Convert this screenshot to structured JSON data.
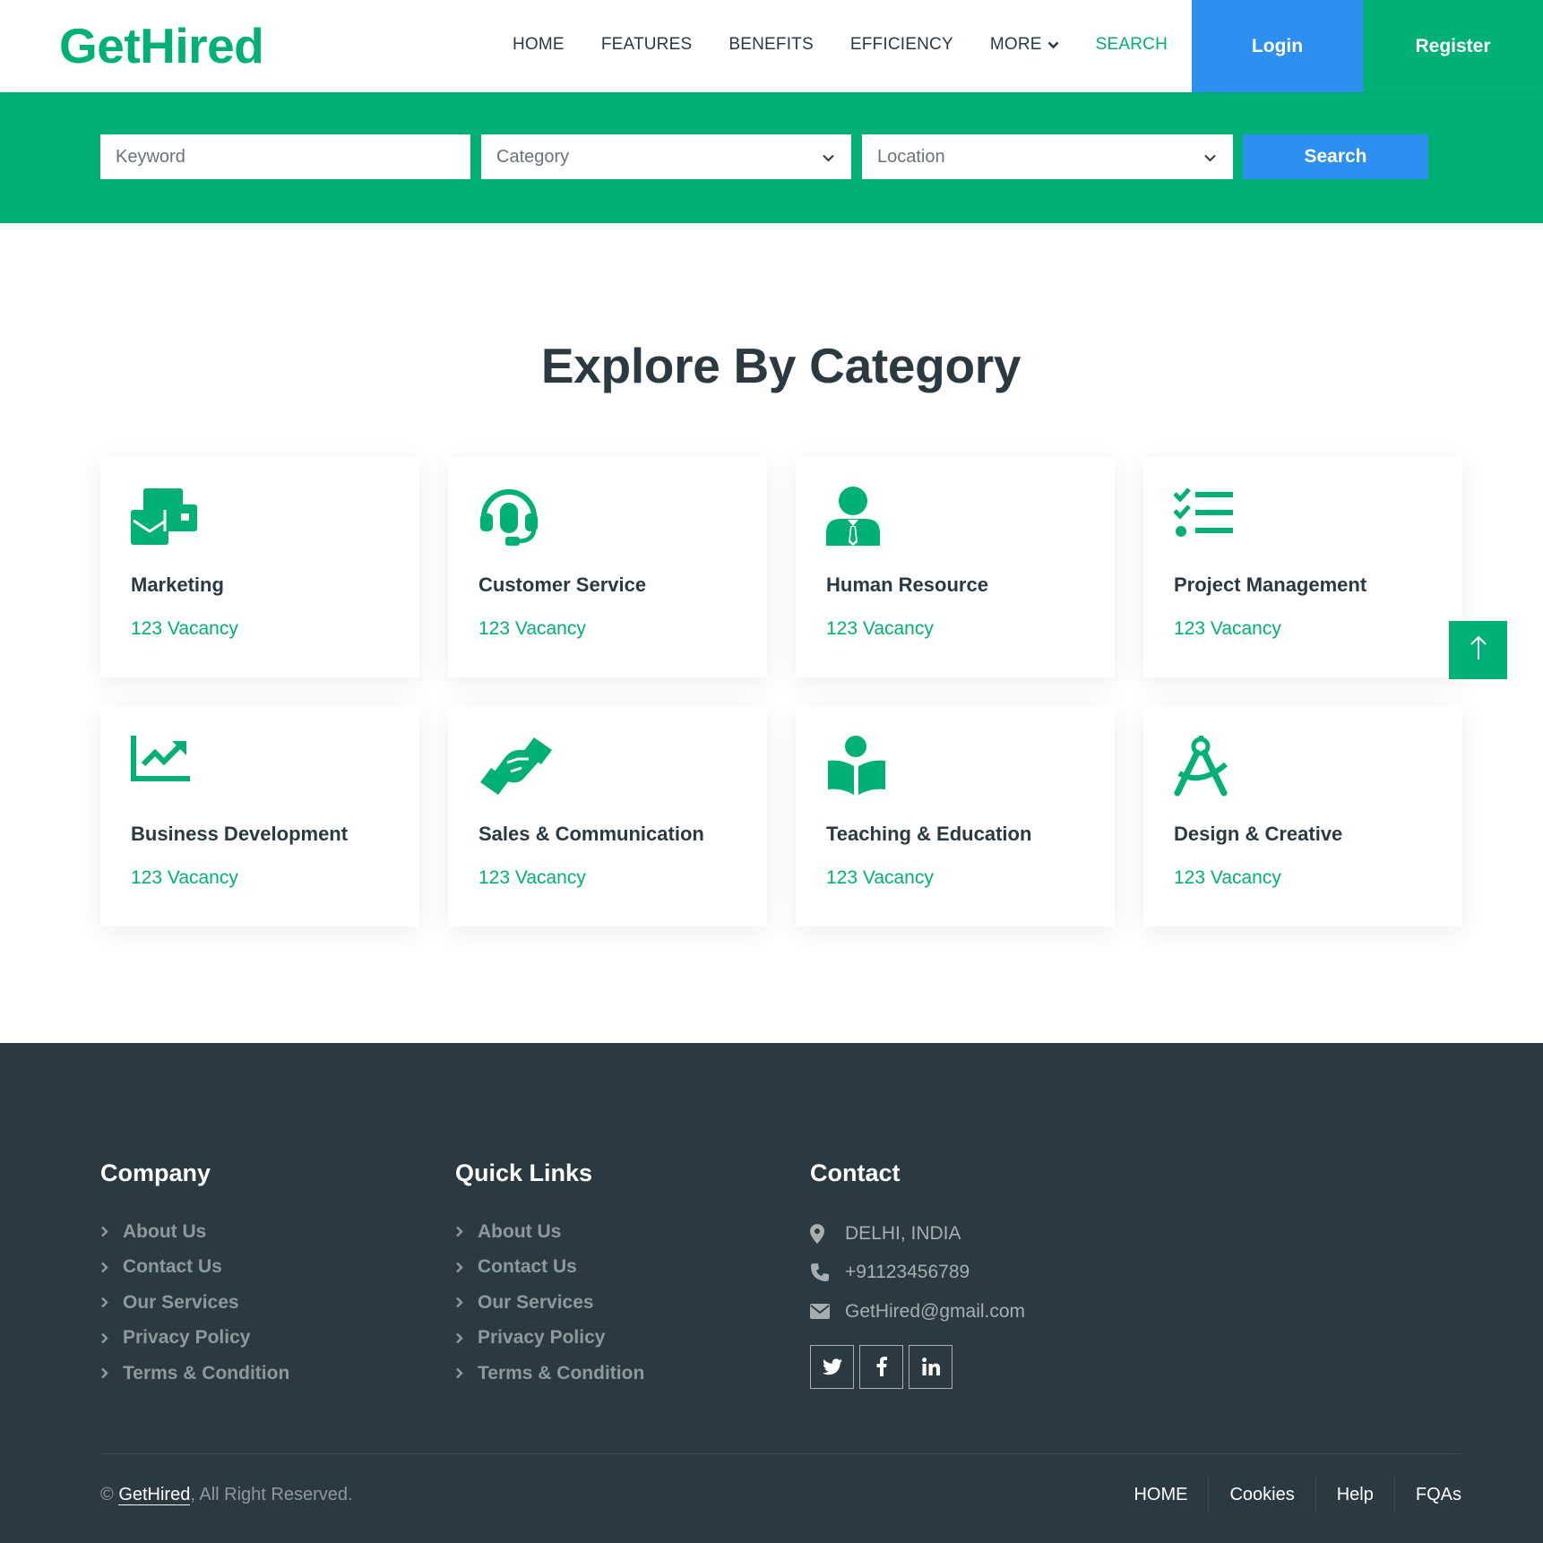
{
  "brand": {
    "logo": "GetHired",
    "accent": "#00b074",
    "blue": "#2d8ff0",
    "dark": "#2b3a42"
  },
  "nav": {
    "items": [
      "HOME",
      "FEATURES",
      "BENEFITS",
      "EFFICIENCY",
      "MORE",
      "SEARCH"
    ],
    "active": "SEARCH",
    "login": "Login",
    "register": "Register"
  },
  "search": {
    "keyword_placeholder": "Keyword",
    "category_placeholder": "Category",
    "location_placeholder": "Location",
    "button": "Search"
  },
  "categories": {
    "title": "Explore By Category",
    "items": [
      {
        "name": "Marketing",
        "count": "123 Vacancy",
        "icon": "envelope-open-icon"
      },
      {
        "name": "Customer Service",
        "count": "123 Vacancy",
        "icon": "headset-icon"
      },
      {
        "name": "Human Resource",
        "count": "123 Vacancy",
        "icon": "user-tie-icon"
      },
      {
        "name": "Project Management",
        "count": "123 Vacancy",
        "icon": "tasks-icon"
      },
      {
        "name": "Business Development",
        "count": "123 Vacancy",
        "icon": "chart-line-icon"
      },
      {
        "name": "Sales & Communication",
        "count": "123 Vacancy",
        "icon": "handshake-icon"
      },
      {
        "name": "Teaching & Education",
        "count": "123 Vacancy",
        "icon": "book-reader-icon"
      },
      {
        "name": "Design & Creative",
        "count": "123 Vacancy",
        "icon": "drafting-compass-icon"
      }
    ]
  },
  "footer": {
    "company": {
      "title": "Company",
      "links": [
        "About Us",
        "Contact Us",
        "Our Services",
        "Privacy Policy",
        "Terms & Condition"
      ]
    },
    "quick_links": {
      "title": "Quick Links",
      "links": [
        "About Us",
        "Contact Us",
        "Our Services",
        "Privacy Policy",
        "Terms & Condition"
      ]
    },
    "contact": {
      "title": "Contact",
      "location": "DELHI, INDIA",
      "phone": "+91123456789",
      "email": "GetHired@gmail.com",
      "socials": [
        "twitter-icon",
        "facebook-icon",
        "linkedin-icon"
      ]
    },
    "copyright": {
      "symbol": "©",
      "brand": "GetHired",
      "suffix": ", All Right Reserved."
    },
    "bottom_links": [
      "HOME",
      "Cookies",
      "Help",
      "FQAs"
    ]
  }
}
